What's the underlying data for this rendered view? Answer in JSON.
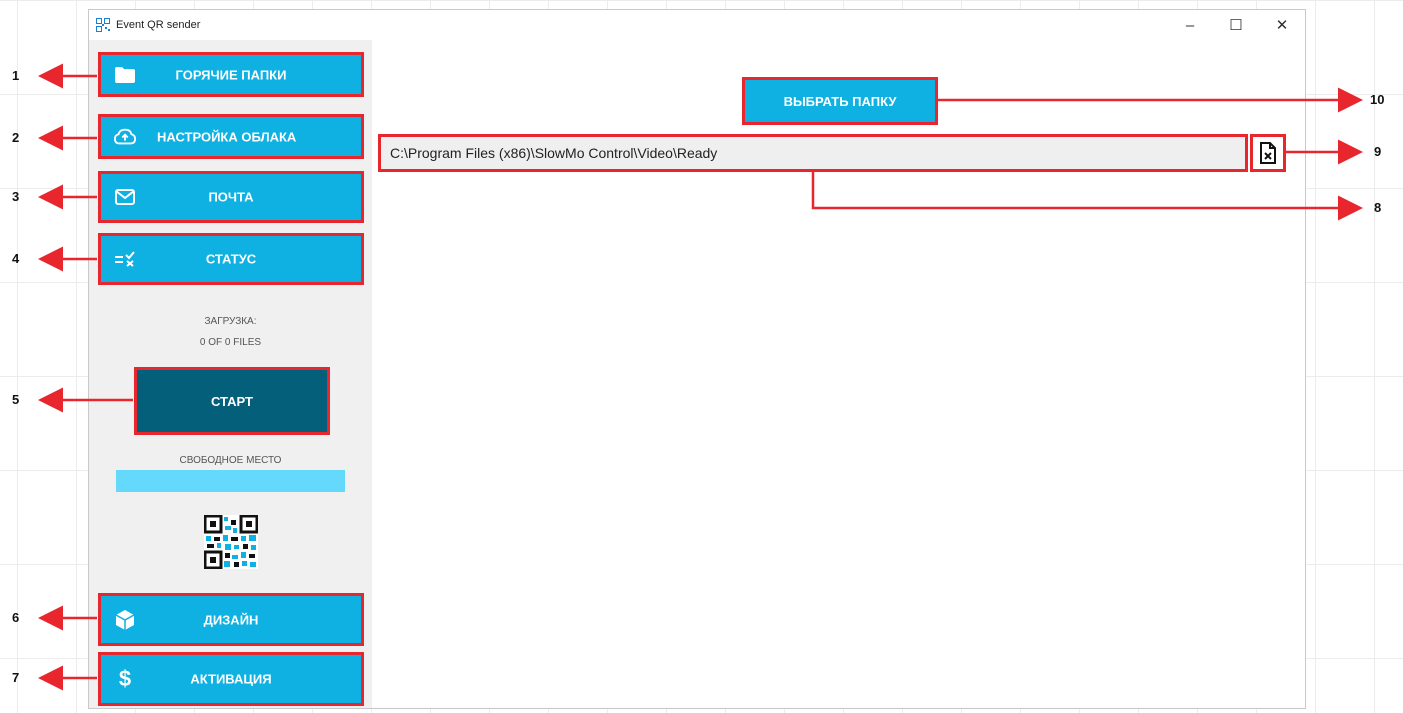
{
  "window": {
    "title": "Event QR sender",
    "controls": {
      "minimize": "–",
      "maximize": "☐",
      "close": "✕"
    }
  },
  "sidebar": {
    "items": [
      {
        "label": "ГОРЯЧИЕ ПАПКИ",
        "icon": "folder-icon"
      },
      {
        "label": "НАСТРОЙКА ОБЛАКА",
        "icon": "cloud-upload-icon"
      },
      {
        "label": "ПОЧТА",
        "icon": "mail-icon"
      },
      {
        "label": "СТАТУС",
        "icon": "checklist-icon"
      },
      {
        "label": "ДИЗАЙН",
        "icon": "cube-icon"
      },
      {
        "label": "АКТИВАЦИЯ",
        "icon": "dollar-icon"
      }
    ],
    "upload_label": "ЗАГРУЗКА:",
    "upload_count": "0 OF 0 FILES",
    "start_label": "СТАРТ",
    "free_space_label": "СВОБОДНОЕ МЕСТО",
    "free_space_fraction": 1.0
  },
  "main": {
    "choose_folder_label": "ВЫБРАТЬ ПАПКУ",
    "folder_path": "C:\\Program Files (x86)\\SlowMo Control\\Video\\Ready",
    "clear_icon": "file-remove-icon"
  },
  "callouts": [
    "1",
    "2",
    "3",
    "4",
    "5",
    "6",
    "7",
    "8",
    "9",
    "10"
  ],
  "colors": {
    "accent": "#0eb1e1",
    "start": "#04607a",
    "highlight": "#e8262d",
    "space_fill": "#64d9fb",
    "sidebar_bg": "#f0f0f0"
  }
}
